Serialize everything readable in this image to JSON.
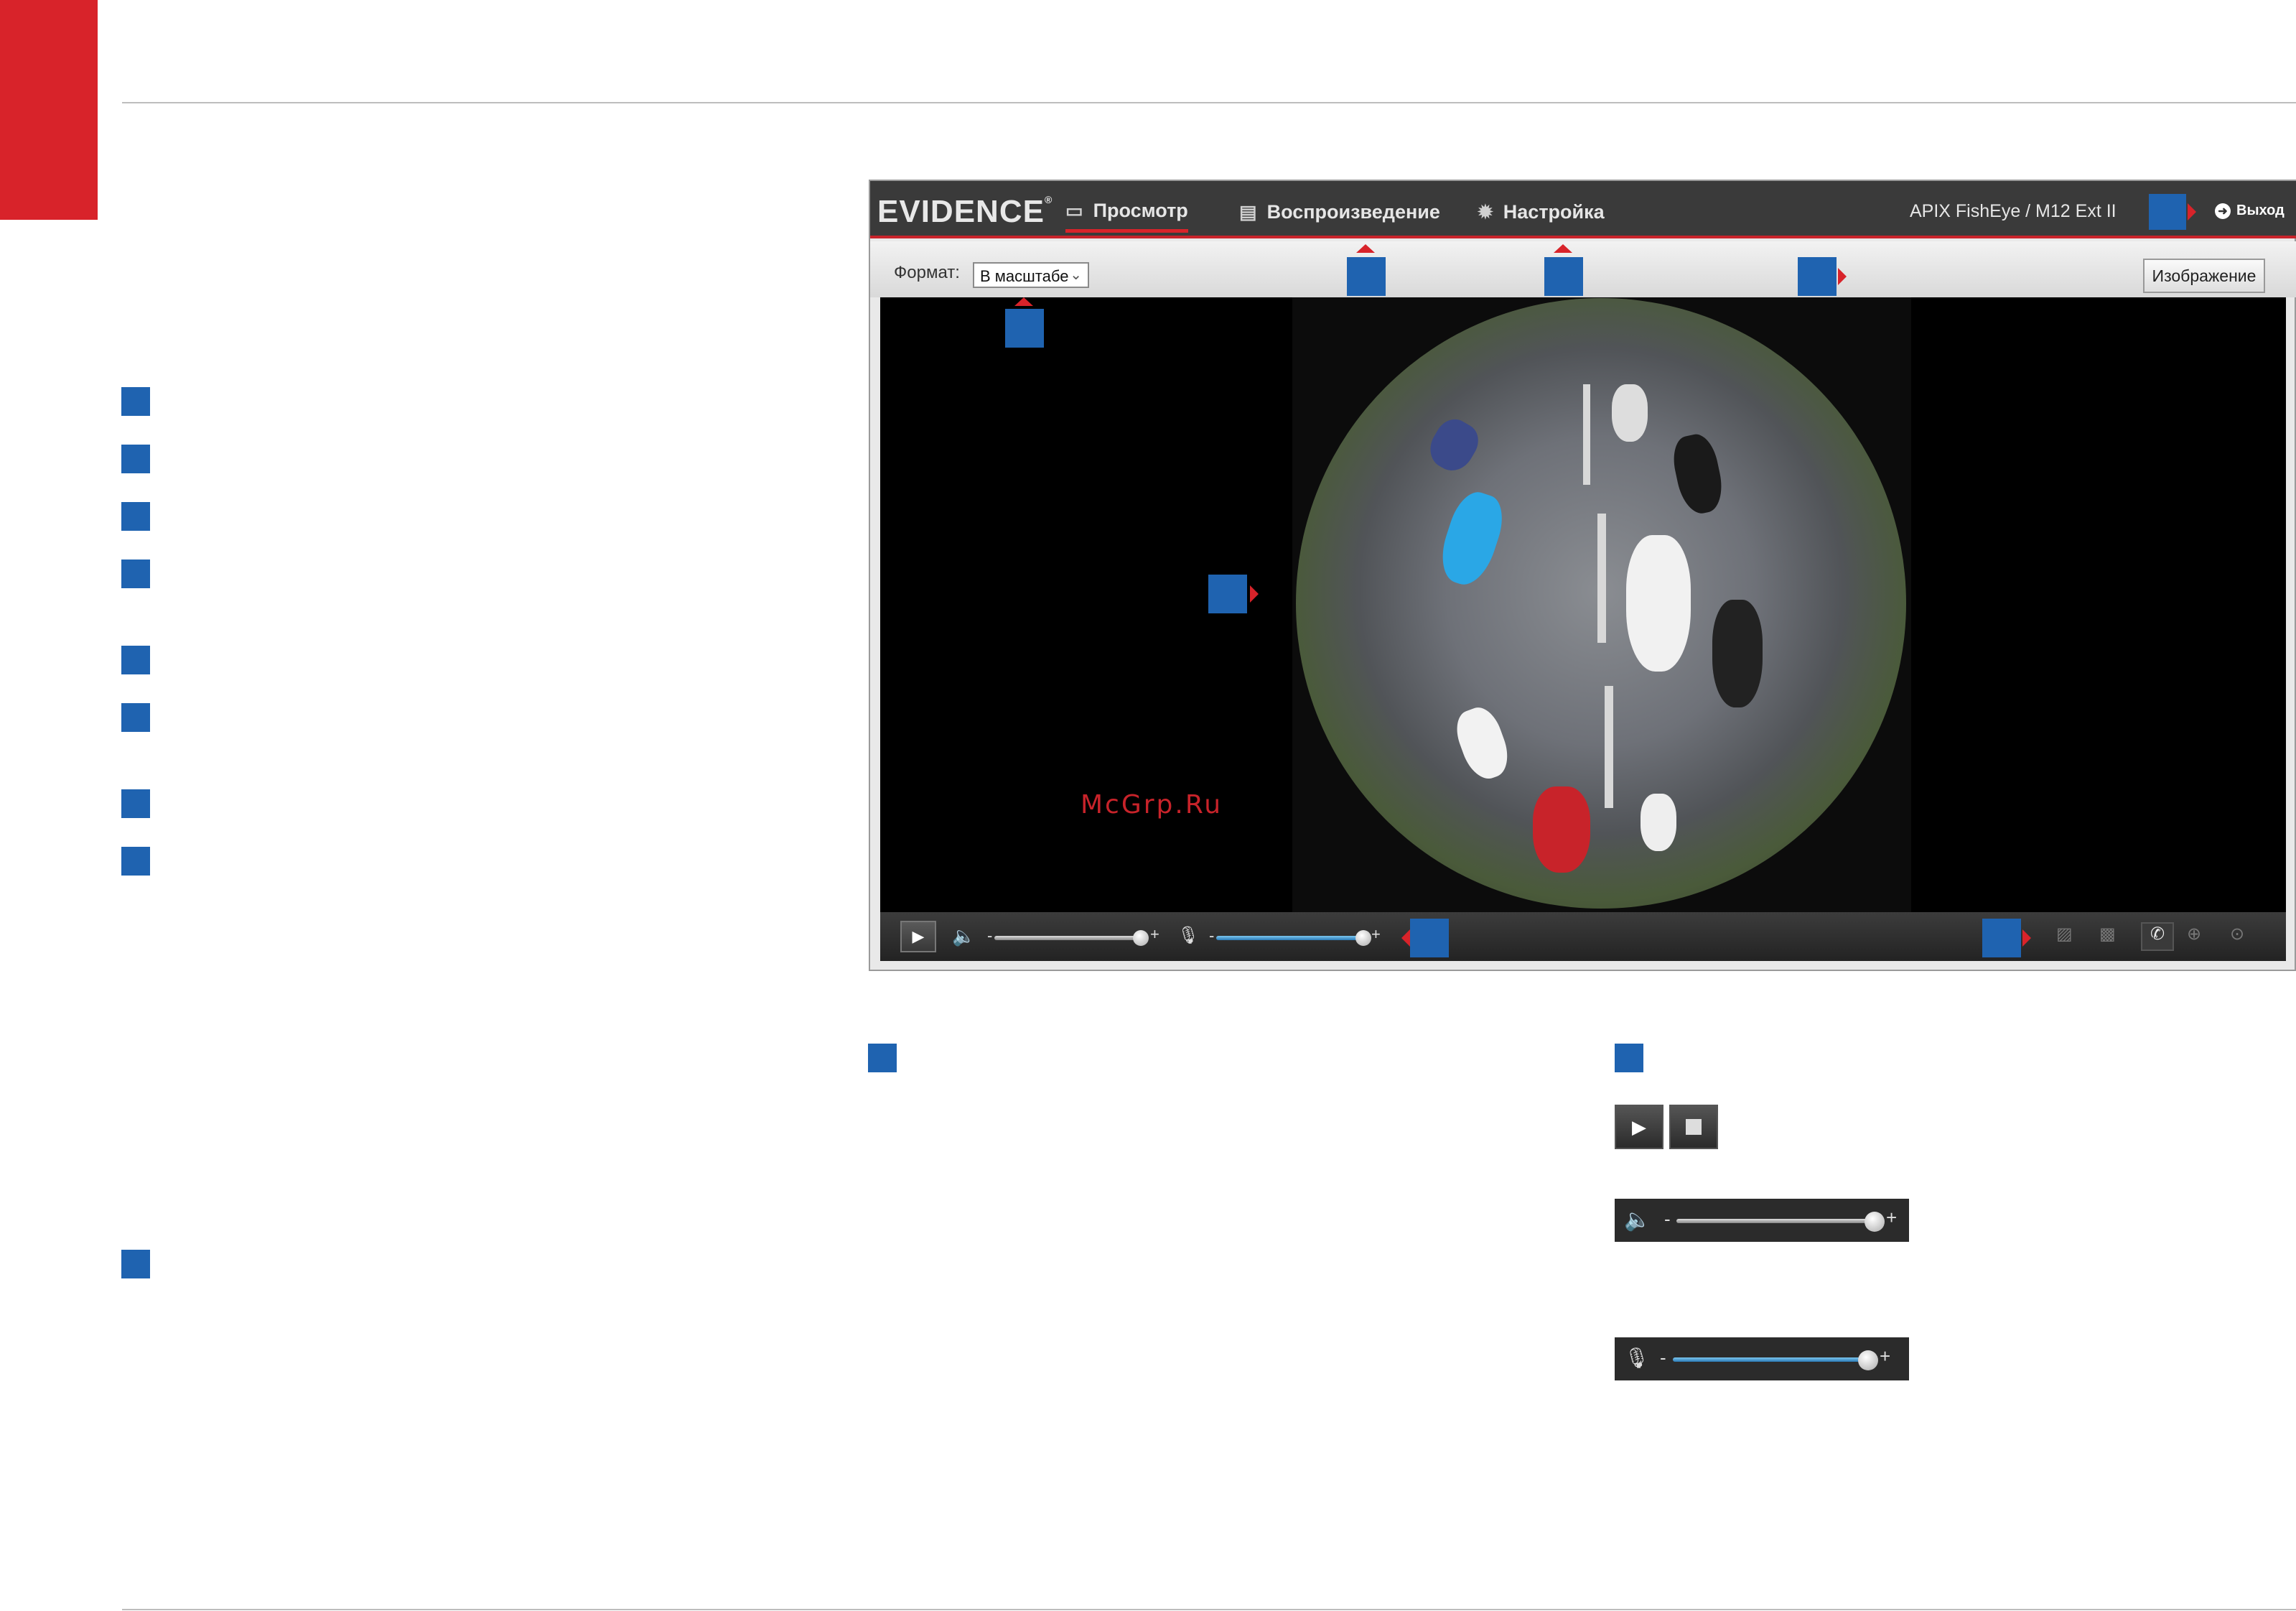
{
  "brand": {
    "name": "EVIDENCE",
    "mark": "®"
  },
  "nav": {
    "tabs": [
      {
        "label": "Просмотр",
        "icon": "monitor-icon",
        "active": true
      },
      {
        "label": "Воспроизведение",
        "icon": "playback-icon",
        "active": false
      },
      {
        "label": "Настройка",
        "icon": "gear-icon",
        "active": false
      }
    ],
    "device": "APIX FishEye / M12 Ext II",
    "exit_label": "Выход"
  },
  "toolbar": {
    "format_label": "Формат:",
    "format_value": "В масштабе",
    "image_button": "Изображение"
  },
  "watermark": "McGrp.Ru",
  "controls": {
    "volume_level": 0.95,
    "mic_level": 0.95,
    "minus": "-",
    "plus": "+",
    "tools": [
      "snapshot-icon",
      "record-icon",
      "talk-icon",
      "zoom-icon",
      "ptz-icon"
    ]
  },
  "colors": {
    "accent_red": "#d8232a",
    "marker_blue": "#1f63b0",
    "topbar": "#3a3a3a"
  }
}
